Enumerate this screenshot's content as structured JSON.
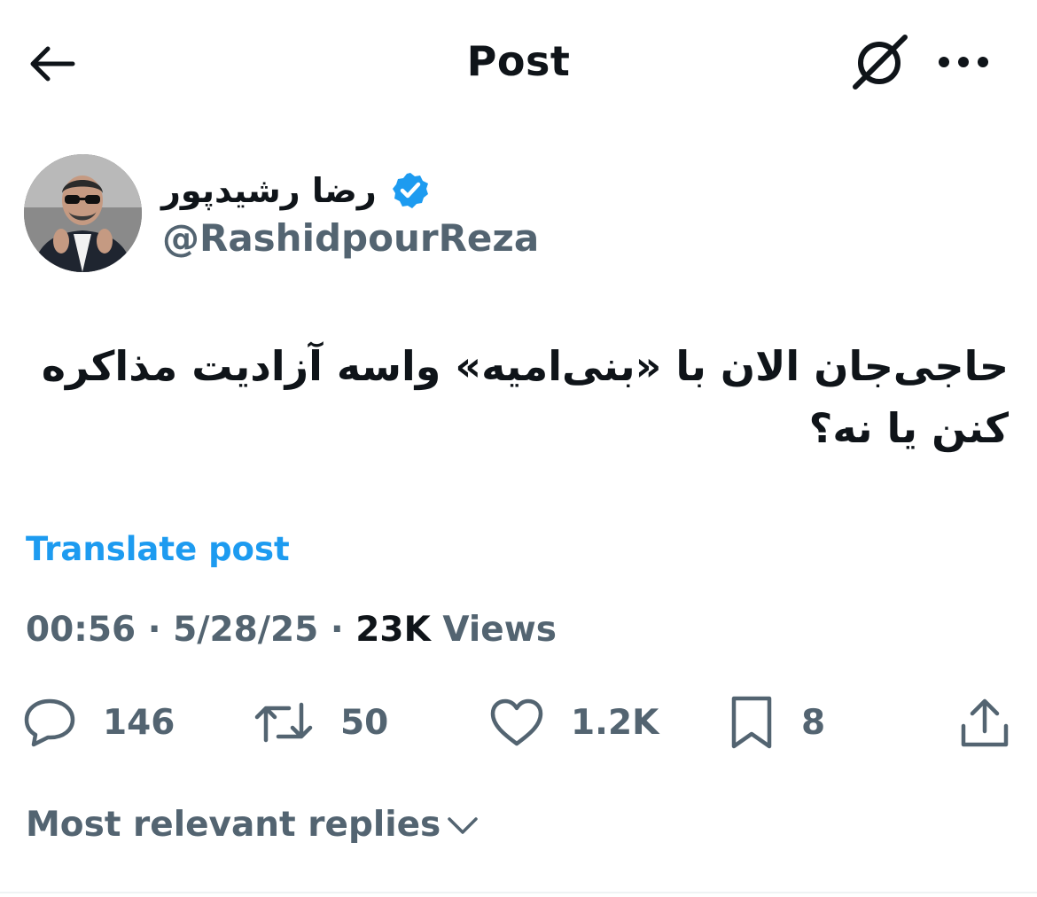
{
  "header": {
    "title": "Post",
    "back_icon": "arrow-left-icon",
    "grok_icon": "grok-icon",
    "more_icon": "more-horizontal-icon"
  },
  "author": {
    "name": "رضا رشیدپور",
    "handle": "@RashidpourReza",
    "verified": true,
    "verified_color": "#1d9bf0"
  },
  "post": {
    "text": "حاجی‌جان الان با «بنی‌امیه» واسه آزادیت مذاکره\nکنن یا نه؟",
    "translate_label": "Translate post",
    "time": "00:56",
    "date": "5/28/25",
    "views_count": "23K",
    "views_label": "Views",
    "separator": "·"
  },
  "actions": {
    "replies": "146",
    "reposts": "50",
    "likes": "1.2K",
    "bookmarks": "8"
  },
  "replies_sort": {
    "label": "Most relevant replies"
  },
  "colors": {
    "accent": "#1d9bf0",
    "text_primary": "#0f1419",
    "text_secondary": "#536471"
  }
}
